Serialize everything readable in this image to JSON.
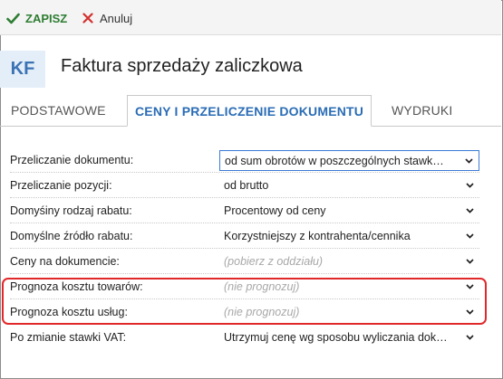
{
  "toolbar": {
    "save_label": "ZAPISZ",
    "cancel_label": "Anuluj"
  },
  "header": {
    "badge": "KF",
    "title": "Faktura sprzedaży zaliczkowa"
  },
  "tabs": [
    {
      "label": "PODSTAWOWE",
      "active": false
    },
    {
      "label": "CENY I PRZELICZENIE DOKUMENTU",
      "active": true
    },
    {
      "label": "WYDRUKI",
      "active": false
    }
  ],
  "form": {
    "rows": [
      {
        "label": "Przeliczanie dokumentu:",
        "value": "od sum obrotów w poszczególnych stawk…",
        "placeholder": false
      },
      {
        "label": "Przeliczanie pozycji:",
        "value": "od brutto",
        "placeholder": false
      },
      {
        "label": "Domyśiny rodzaj rabatu:",
        "value": "Procentowy od ceny",
        "placeholder": false
      },
      {
        "label": "Domyślne źródło rabatu:",
        "value": "Korzystniejszy z kontrahenta/cennika",
        "placeholder": false
      },
      {
        "label": "Ceny na dokumencie:",
        "value": "(pobierz z oddziału)",
        "placeholder": true
      },
      {
        "label": "Prognoza kosztu towarów:",
        "value": "(nie prognozuj)",
        "placeholder": true
      },
      {
        "label": "Prognoza kosztu usług:",
        "value": "(nie prognozuj)",
        "placeholder": true
      },
      {
        "label": "Po zmianie stawki VAT:",
        "value": "Utrzymuj cenę wg sposobu wyliczania dok…",
        "placeholder": false
      }
    ]
  },
  "colors": {
    "accent": "#2a6cb5",
    "save_green": "#2e7d32",
    "cancel_red": "#d32f2f",
    "highlight_red": "#e0282b",
    "badge_bg": "#e4eef8"
  },
  "icons": {
    "save": "check-icon",
    "cancel": "x-icon",
    "dropdown": "chevron-down-icon"
  }
}
